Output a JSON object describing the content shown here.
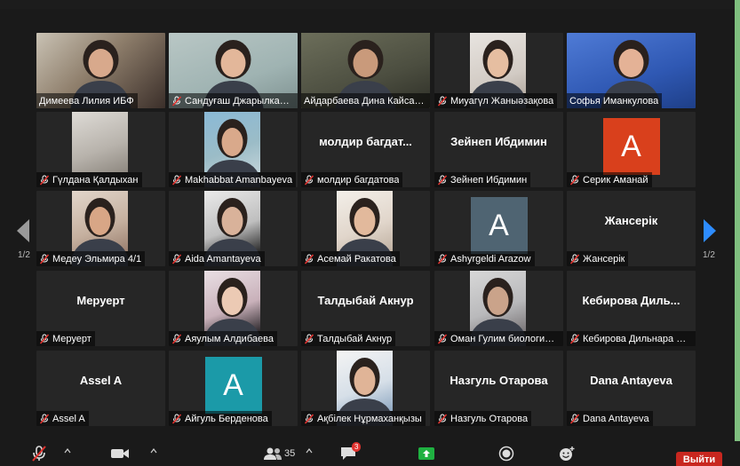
{
  "meeting": {
    "page_indicator_left": "1/2",
    "page_indicator_right": "1/2"
  },
  "participants": [
    {
      "name": "Димеева Лилия ИБФ",
      "display": "video",
      "muted": false
    },
    {
      "name": "Сандуғаш Джарылкапо...",
      "display": "video",
      "muted": true
    },
    {
      "name": "Айдарбаева Дина Кайсар...",
      "display": "video",
      "muted": false,
      "active_speaker": true
    },
    {
      "name": "Миуагүл Жаныәзақова",
      "display": "video",
      "muted": true
    },
    {
      "name": "Софья Иманкулова",
      "display": "video",
      "muted": false
    },
    {
      "name": "Гүлдана Қалдыхан",
      "display": "video",
      "muted": true
    },
    {
      "name": "Makhabbat Amanbayeva",
      "display": "video",
      "muted": true
    },
    {
      "name": "молдир багдатова",
      "display": "name",
      "center_name": "молдир багдат...",
      "muted": true
    },
    {
      "name": "Зейнеп Ибдимин",
      "display": "name",
      "center_name": "Зейнеп Ибдимин",
      "muted": true
    },
    {
      "name": "Серик Аманай",
      "display": "avatar",
      "avatar_letter": "A",
      "avatar_color": "#d9401c",
      "muted": true
    },
    {
      "name": "Медеу Эльмира 4/1",
      "display": "video",
      "muted": true
    },
    {
      "name": "Aida Amantayeva",
      "display": "video",
      "muted": true
    },
    {
      "name": "Асемай Ракатова",
      "display": "video",
      "muted": true
    },
    {
      "name": "Ashyrgeldi Arazow",
      "display": "avatar",
      "avatar_letter": "A",
      "avatar_color": "#4f6472",
      "muted": true
    },
    {
      "name": "Жансерік",
      "display": "name",
      "center_name": "Жансерік",
      "muted": true
    },
    {
      "name": "Меруерт",
      "display": "name",
      "center_name": "Меруерт",
      "muted": true
    },
    {
      "name": "Аяулым Алдибаева",
      "display": "video",
      "muted": true
    },
    {
      "name": "Талдыбай Акнур",
      "display": "name",
      "center_name": "Талдыбай Акнур",
      "muted": true
    },
    {
      "name": "Оман Гулим биология ...",
      "display": "video",
      "muted": true
    },
    {
      "name": "Кебирова Дильнара Би...",
      "display": "name",
      "center_name": "Кебирова Диль...",
      "muted": true
    },
    {
      "name": "Assel A",
      "display": "name",
      "center_name": "Assel A",
      "muted": true
    },
    {
      "name": "Айгуль Берденова",
      "display": "avatar",
      "avatar_letter": "A",
      "avatar_color": "#1b9aa8",
      "muted": true
    },
    {
      "name": "Ақбілек Нұрмаханқызы",
      "display": "video",
      "muted": true
    },
    {
      "name": "Назгуль Отарова",
      "display": "name",
      "center_name": "Назгуль Отарова",
      "muted": true
    },
    {
      "name": "Dana Antayeva",
      "display": "name",
      "center_name": "Dana Antayeva",
      "muted": true
    }
  ],
  "toolbar": {
    "participants_count": "35",
    "chat_badge": "3",
    "leave_label": "Выйти"
  },
  "colors": {
    "active_speaker_border": "#d6e86a",
    "leave_button": "#c8271f",
    "muted_icon": "#e0322e",
    "share_button": "#1fb141",
    "nav_arrow_right": "#2d8cff"
  },
  "icons": {
    "mute": "microphone-muted-icon",
    "video": "video-camera-icon",
    "participants": "people-icon",
    "chat": "chat-bubble-icon",
    "share": "share-screen-icon",
    "record": "record-icon",
    "reactions": "emoji-icon"
  }
}
